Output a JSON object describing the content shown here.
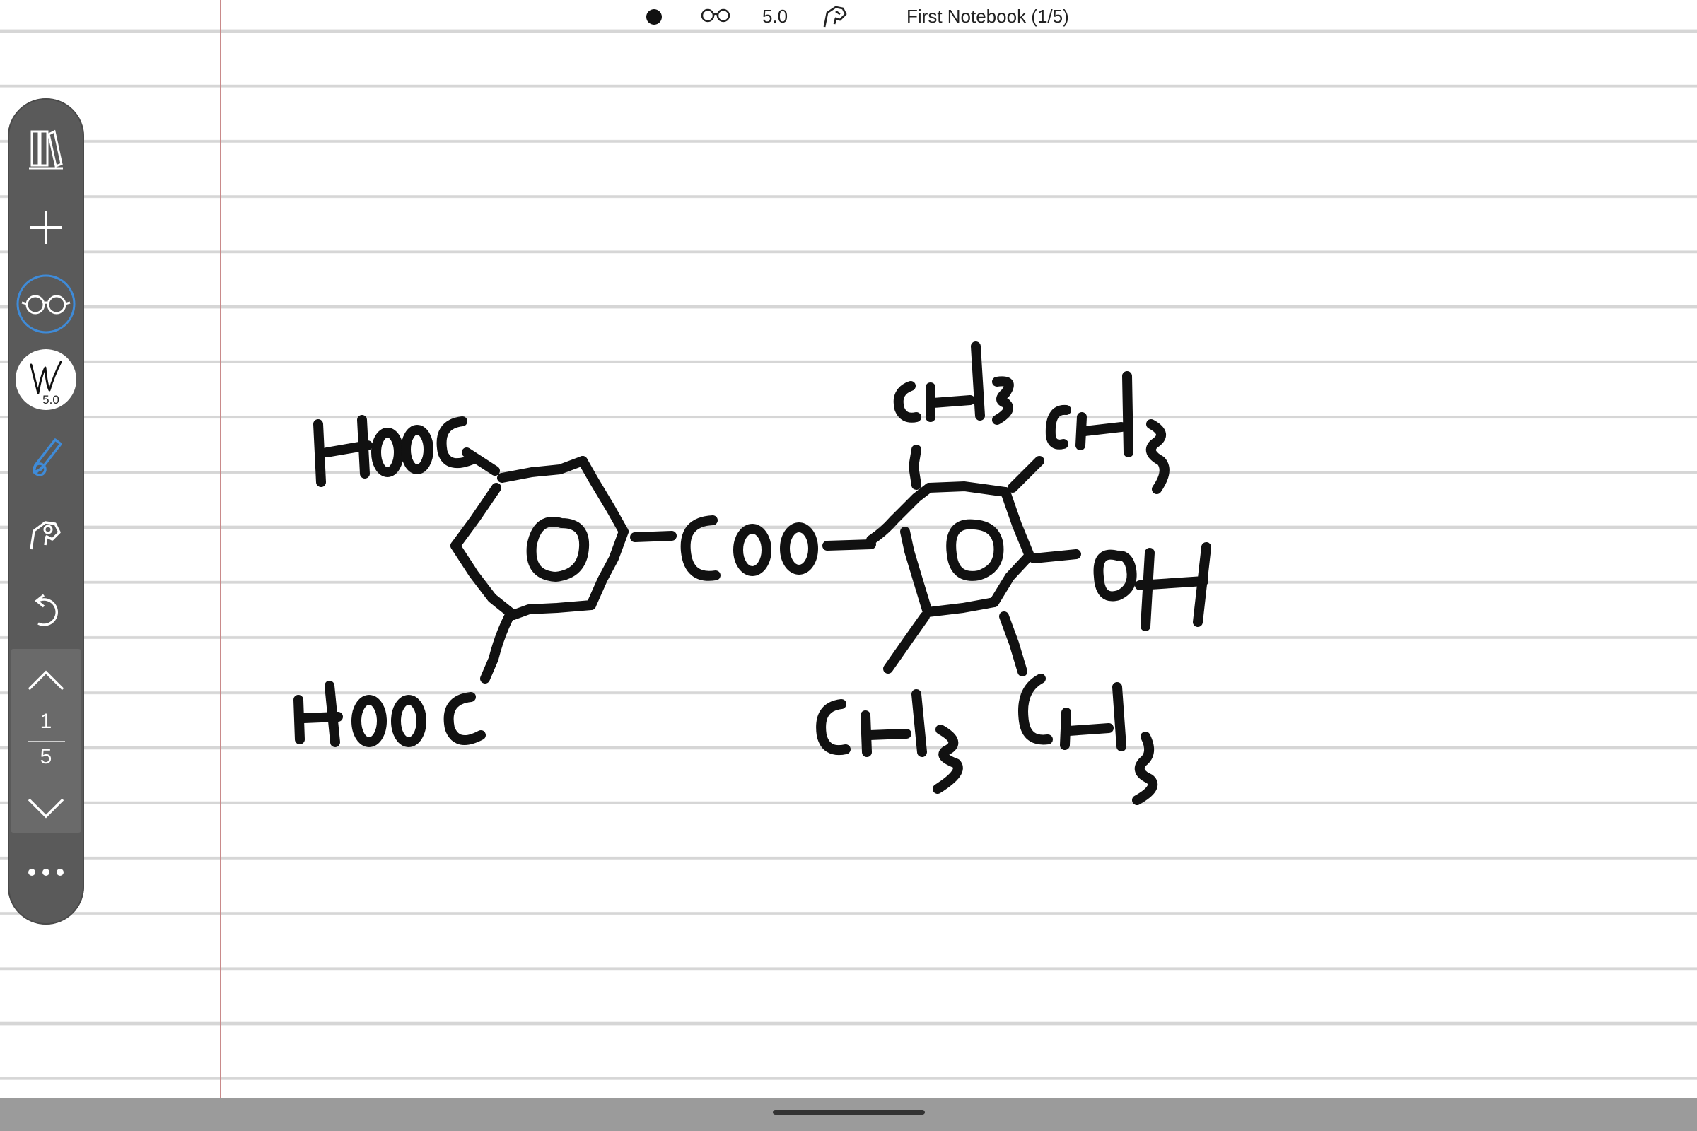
{
  "topbar": {
    "pen_size": "5.0",
    "notebook_title": "First Notebook (1/5)",
    "icons": [
      "brush-color-dot",
      "reading-glasses-icon",
      "hand-writing-icon"
    ]
  },
  "toolbar": {
    "buttons": [
      {
        "icon": "library-books-icon"
      },
      {
        "icon": "add-page-icon"
      },
      {
        "icon": "read-mode-glasses-icon",
        "active": true
      },
      {
        "icon": "pen-tool-icon",
        "size_label": "5.0"
      },
      {
        "icon": "eraser-pencil-icon",
        "accent": "#3f8bd8"
      },
      {
        "icon": "hand-touch-icon"
      },
      {
        "icon": "undo-icon"
      }
    ],
    "pager": {
      "current": "1",
      "total": "5"
    },
    "more_icon": "more-horizontal-icon"
  },
  "notebook": {
    "handwriting": [
      "HOOC",
      "HOOC",
      "O",
      "COO",
      "O",
      "CH3",
      "CH3",
      "OH",
      "CH3",
      "CH3"
    ]
  },
  "colors": {
    "ink": "#111111",
    "toolbar": "#5a5a5a",
    "accent": "#3f8bd8",
    "margin": "#c98a8a",
    "rule": "#d6d6d6"
  }
}
